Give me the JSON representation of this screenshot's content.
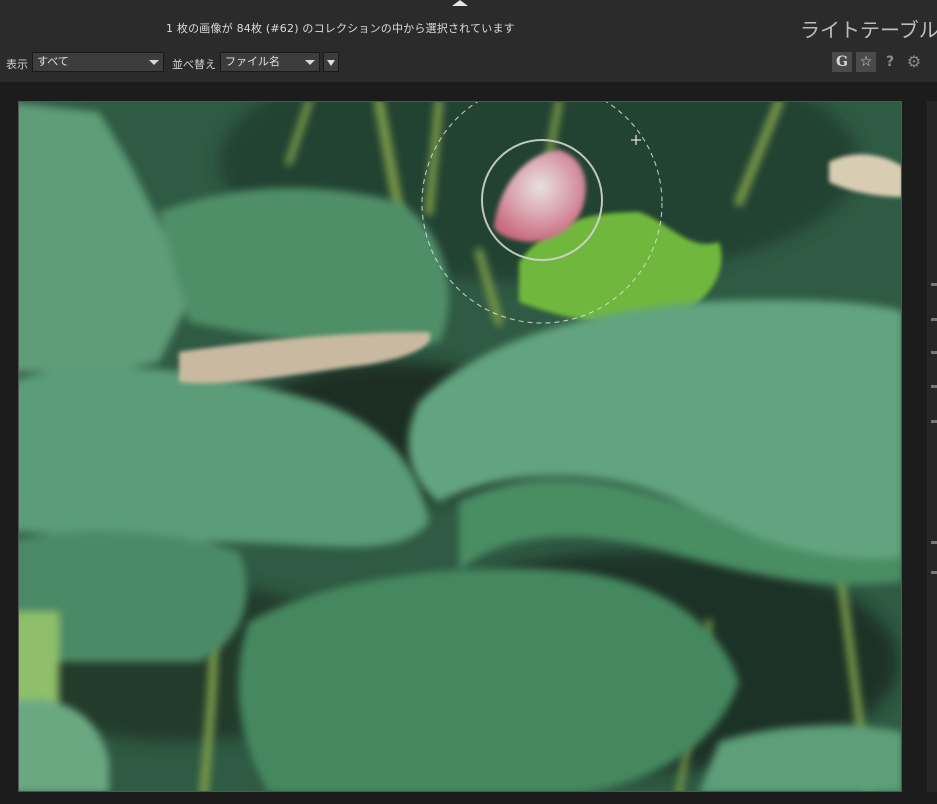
{
  "header": {
    "status_text": "1 枚の画像が 84枚 (#62) のコレクションの中から選択されています",
    "view_title": "ライトテーブル"
  },
  "toolbar": {
    "display_label": "表示",
    "display_value": "すべて",
    "sort_label": "並べ替え",
    "sort_value": "ファイル名",
    "grouping_button": "G",
    "star_button": "☆",
    "help_button": "?",
    "preferences_icon": "gear-icon"
  },
  "viewer": {
    "image_subject": "lotus-bud-among-leaves",
    "overlay": "focus-circles"
  },
  "colors": {
    "background": "#1e1e1e",
    "topbar": "#2b2b2b",
    "leaf_green": "#4f8f68",
    "bright_leaf": "#6fb83c",
    "bud_pink": "#d98a98"
  }
}
